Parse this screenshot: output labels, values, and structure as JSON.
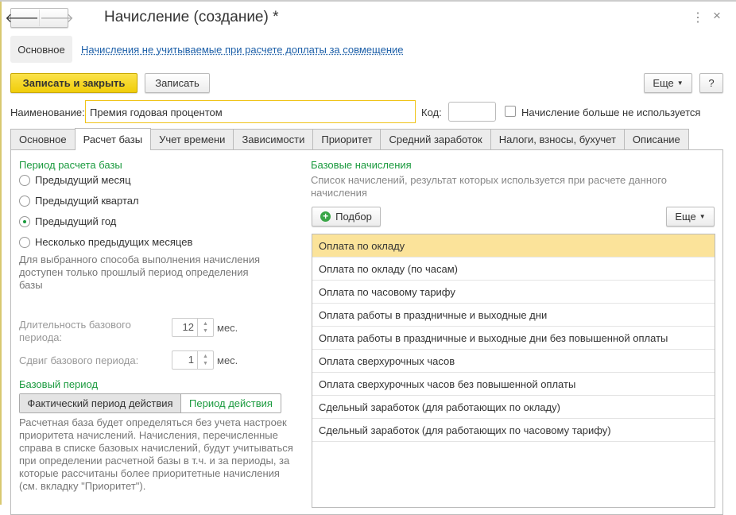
{
  "window": {
    "title": "Начисление (создание) *",
    "more_icon": "⋮",
    "close_icon": "×"
  },
  "nav": {
    "back": "🡐",
    "forward": "🡒"
  },
  "top_links": {
    "main": "Основное",
    "link": "Начисления не учитываемые при расчете доплаты за совмещение"
  },
  "toolbar": {
    "save_close": "Записать и закрыть",
    "save": "Записать",
    "more": "Еще",
    "help": "?"
  },
  "form": {
    "name_label": "Наименование:",
    "name_value": "Премия годовая процентом",
    "code_label": "Код:",
    "code_value": "",
    "unused_label": "Начисление больше не используется",
    "unused_checked": false
  },
  "tabs": [
    "Основное",
    "Расчет базы",
    "Учет времени",
    "Зависимости",
    "Приоритет",
    "Средний заработок",
    "Налоги, взносы, бухучет",
    "Описание"
  ],
  "active_tab": "Расчет базы",
  "left": {
    "period_title": "Период расчета базы",
    "options": [
      "Предыдущий месяц",
      "Предыдущий квартал",
      "Предыдущий год",
      "Несколько предыдущих месяцев"
    ],
    "selected": "Предыдущий год",
    "hint": "Для выбранного способа выполнения начисления доступен только прошлый период определения базы",
    "duration_label": "Длительность базового периода:",
    "duration_value": "12",
    "months": "мес.",
    "shift_label": "Сдвиг базового периода:",
    "shift_value": "1",
    "base_period_title": "Базовый период",
    "toggle": [
      "Фактический период действия",
      "Период действия"
    ],
    "note": "Расчетная база будет определяться без учета настроек приоритета начислений. Начисления, перечисленные справа в списке базовых начислений, будут учитываться при определении расчетной базы в т.ч. и за периоды, за которые рассчитаны более приоритетные начисления (см. вкладку \"Приоритет\")."
  },
  "right": {
    "title": "Базовые начисления",
    "desc": "Список начислений, результат которых используется при расчете данного начисления",
    "pick": "Подбор",
    "more": "Еще",
    "items": [
      "Оплата по окладу",
      "Оплата по окладу (по часам)",
      "Оплата по часовому тарифу",
      "Оплата работы в праздничные и выходные дни",
      "Оплата работы в праздничные и выходные дни без повышенной оплаты",
      "Оплата сверхурочных часов",
      "Оплата сверхурочных часов без повышенной оплаты",
      "Сдельный заработок (для работающих по окладу)",
      "Сдельный заработок (для работающих по часовому тарифу)"
    ]
  },
  "colors": {
    "accent": "#f5d20f",
    "green": "#1a9a3e",
    "selected_row": "#fbe39a"
  }
}
